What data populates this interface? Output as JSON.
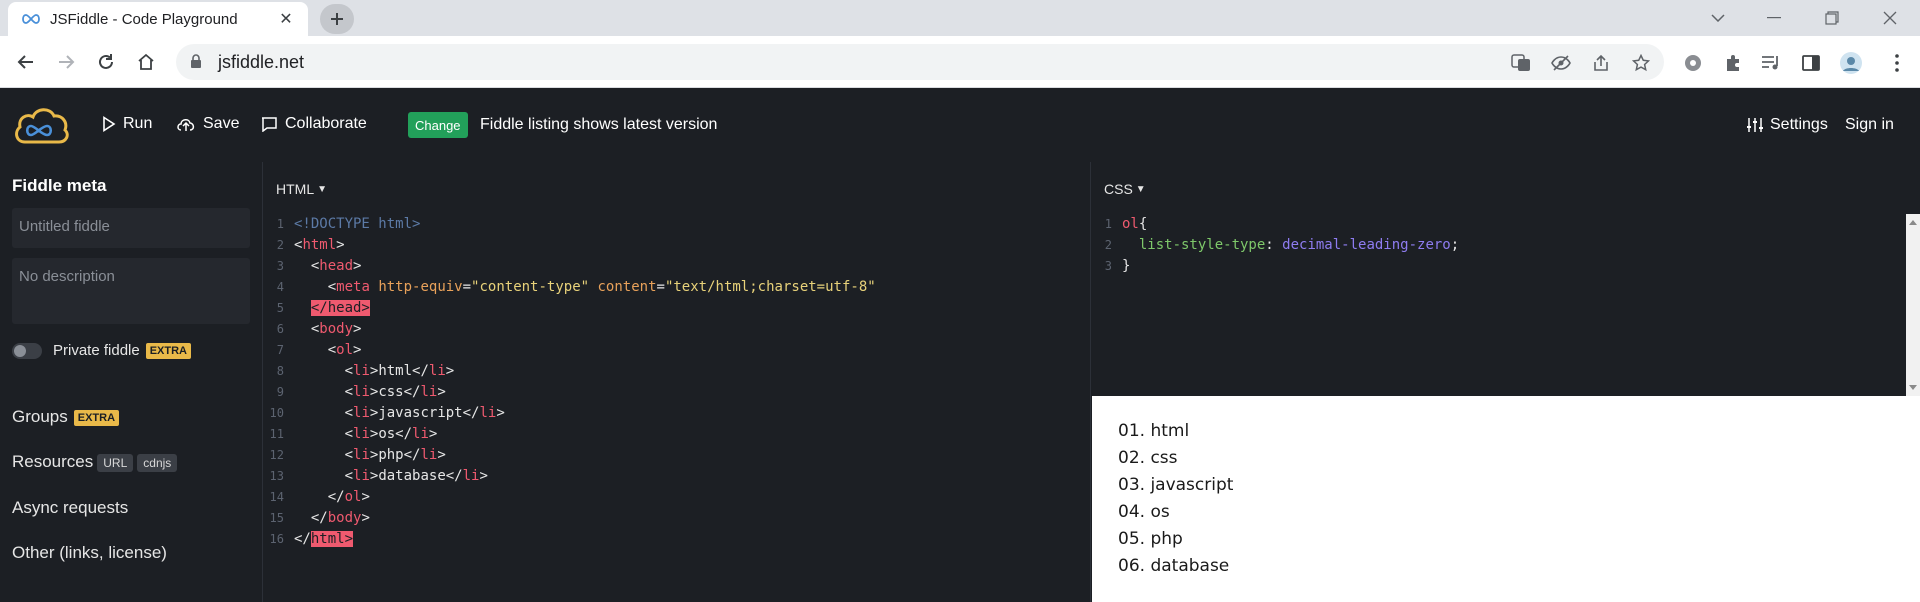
{
  "browser": {
    "tab_title": "JSFiddle - Code Playground",
    "url": "jsfiddle.net"
  },
  "toolbar": {
    "run": "Run",
    "save": "Save",
    "collaborate": "Collaborate",
    "change": "Change",
    "notice": "Fiddle listing shows latest version",
    "settings": "Settings",
    "sign_in": "Sign in"
  },
  "sidebar": {
    "title": "Fiddle meta",
    "name_placeholder": "Untitled fiddle",
    "description_placeholder": "No description",
    "private_label": "Private fiddle",
    "extra": "EXTRA",
    "groups": "Groups",
    "resources": "Resources",
    "resources_url": "URL",
    "resources_cdnjs": "cdnjs",
    "async": "Async requests",
    "other": "Other (links, license)"
  },
  "html_panel": {
    "label": "HTML",
    "line_numbers": [
      "1",
      "2",
      "3",
      "4",
      "5",
      "6",
      "7",
      "8",
      "9",
      "10",
      "11",
      "12",
      "13",
      "14",
      "15",
      "16"
    ],
    "doctype": "<!DOCTYPE html>",
    "items": [
      "html",
      "css",
      "javascript",
      "os",
      "php",
      "database"
    ],
    "meta_attr1": "http-equiv",
    "meta_val1": "\"content-type\"",
    "meta_attr2": "content",
    "meta_val2": "\"text/html;charset=utf-8\""
  },
  "css_panel": {
    "label": "CSS",
    "line_numbers": [
      "1",
      "2",
      "3"
    ],
    "selector": "ol",
    "property": "list-style-type",
    "value": "decimal-leading-zero"
  },
  "result": {
    "items": [
      "01. html",
      "02. css",
      "03. javascript",
      "04. os",
      "05. php",
      "06. database"
    ]
  },
  "colors": {
    "accent_green": "#22a05a",
    "extra_badge": "#e9b949",
    "tag_red": "#ef5a6f"
  }
}
